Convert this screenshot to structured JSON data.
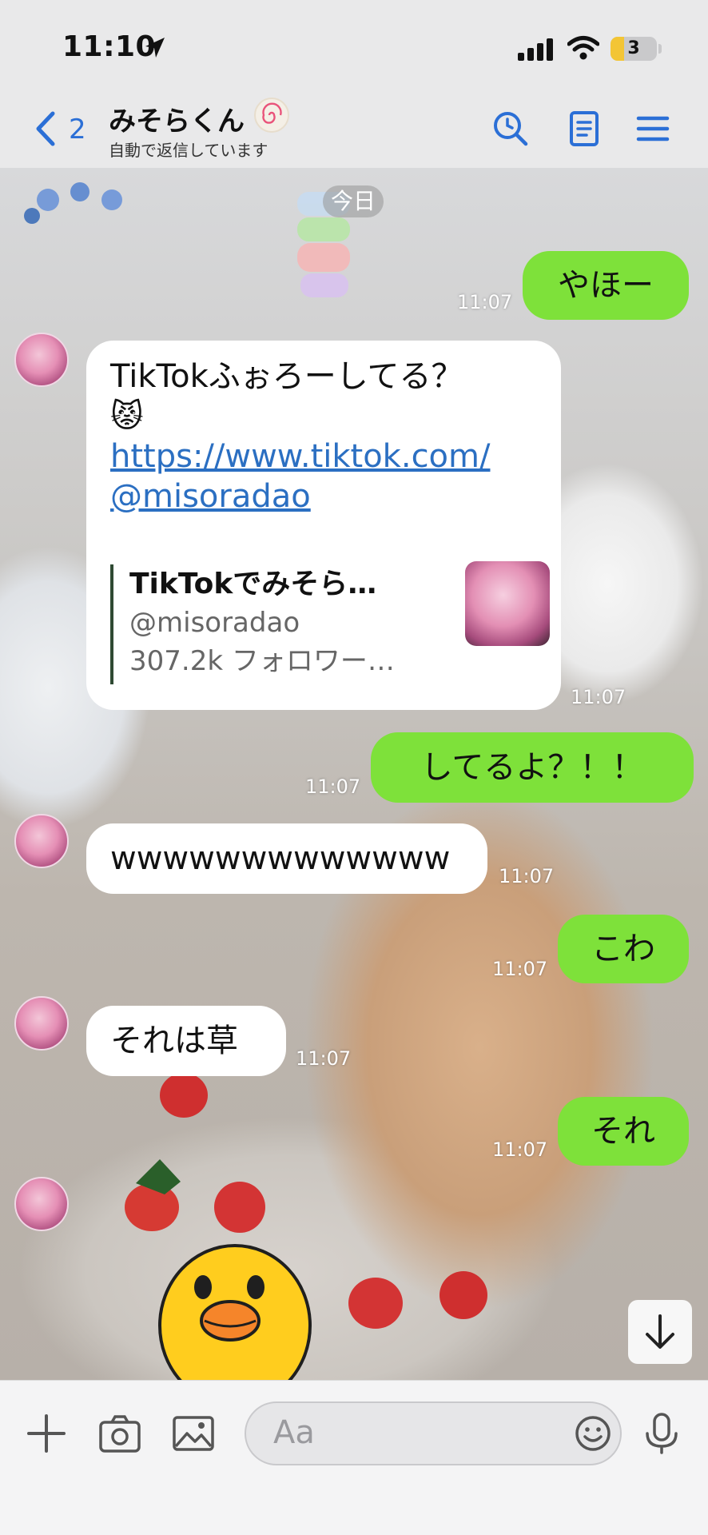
{
  "status_bar": {
    "time": "11:10",
    "battery": "3",
    "battery_level": 0.3
  },
  "header": {
    "back_count": "2",
    "contact_name": "みそらくん",
    "contact_status": "自動で返信しています",
    "icons": [
      "search-icon",
      "notes-icon",
      "menu-icon"
    ]
  },
  "chat": {
    "date_label": "今日",
    "messages": [
      {
        "from": "me",
        "text": "やほー",
        "time": "11:07"
      },
      {
        "from": "them",
        "text": "TikTokふぉろーしてる？",
        "emoji": "😾",
        "link": [
          "https://www.tiktok.com/",
          "@misoradao"
        ],
        "preview": {
          "title": "TikTokでみそら…",
          "handle": "@misoradao",
          "followers": "307.2k フォロワー…"
        },
        "time": "11:07"
      },
      {
        "from": "me",
        "text": "してるよ？！！",
        "time": "11:07"
      },
      {
        "from": "them",
        "text": "wwwwwwwwwwwww",
        "time": "11:07"
      },
      {
        "from": "me",
        "text": "こわ",
        "time": "11:07"
      },
      {
        "from": "them",
        "text": "それは草",
        "time": "11:07"
      },
      {
        "from": "me",
        "text": "それ",
        "time": "11:07"
      }
    ]
  },
  "input": {
    "placeholder": "Aa"
  },
  "colors": {
    "accent": "#2b6fd6",
    "out_bubble": "#7ee13a",
    "in_bubble": "#ffffff"
  }
}
